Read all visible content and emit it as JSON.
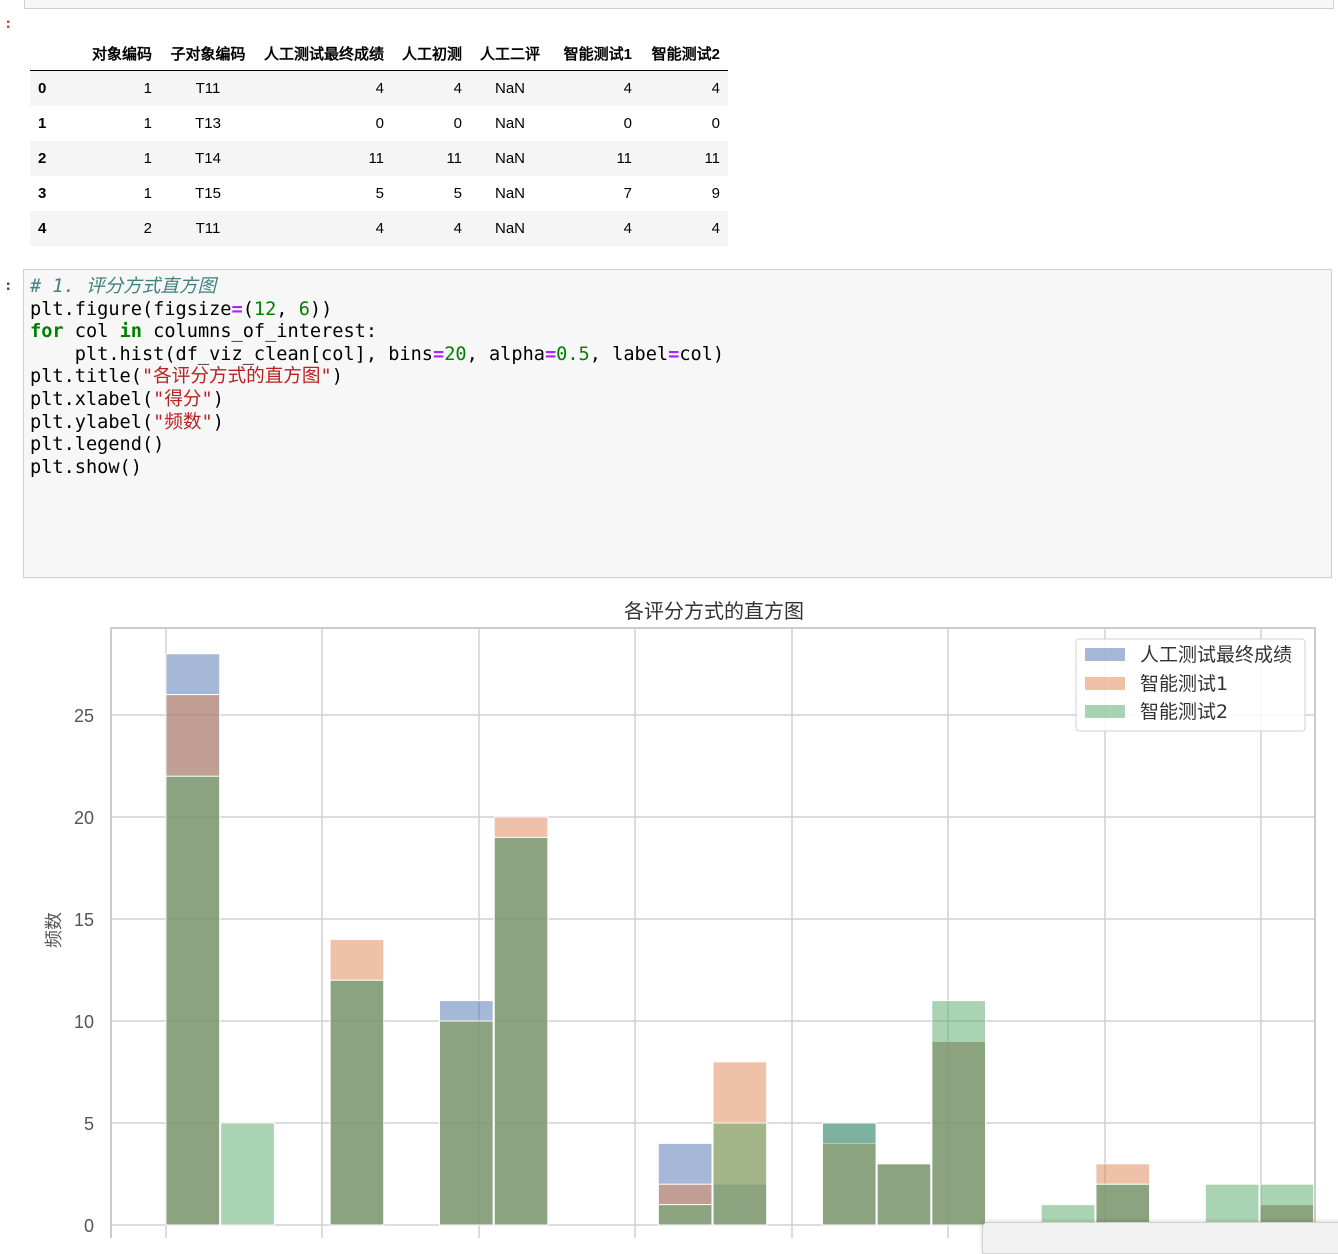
{
  "prompts": {
    "output": ":",
    "input": ":"
  },
  "dataframe": {
    "columns": [
      "对象编码",
      "子对象编码",
      "人工测试最终成绩",
      "人工初测",
      "人工二评",
      "智能测试1",
      "智能测试2"
    ],
    "rows": [
      {
        "index": "0",
        "cells": [
          "1",
          "T11",
          "4",
          "4",
          "NaN",
          "4",
          "4"
        ]
      },
      {
        "index": "1",
        "cells": [
          "1",
          "T13",
          "0",
          "0",
          "NaN",
          "0",
          "0"
        ]
      },
      {
        "index": "2",
        "cells": [
          "1",
          "T14",
          "11",
          "11",
          "NaN",
          "11",
          "11"
        ]
      },
      {
        "index": "3",
        "cells": [
          "1",
          "T15",
          "5",
          "5",
          "NaN",
          "7",
          "9"
        ]
      },
      {
        "index": "4",
        "cells": [
          "2",
          "T11",
          "4",
          "4",
          "NaN",
          "4",
          "4"
        ]
      }
    ]
  },
  "code": {
    "line1": "# 1. 评分方式直方图",
    "fig_prefix": "plt.figure(figsize",
    "fig_eq": "=",
    "fig_open": "(",
    "fig_n1": "12",
    "fig_comma": ", ",
    "fig_n2": "6",
    "fig_close": "))",
    "for_kw": "for",
    "for_mid": " col ",
    "in_kw": "in",
    "for_rest": " columns_of_interest:",
    "hist_a": "    plt.hist(df_viz_clean[col], bins",
    "eq1": "=",
    "bins_val": "20",
    "hist_b": ", alpha",
    "eq2": "=",
    "alpha_val": "0.5",
    "hist_c": ", label",
    "eq3": "=",
    "hist_d": "col)",
    "title_a": "plt.title(",
    "title_str": "\"各评分方式的直方图\"",
    "title_b": ")",
    "xlabel_a": "plt.xlabel(",
    "xlabel_str": "\"得分\"",
    "xlabel_b": ")",
    "ylabel_a": "plt.ylabel(",
    "ylabel_str": "\"频数\"",
    "ylabel_b": ")",
    "legend_line": "plt.legend()",
    "show_line": "plt.show()"
  },
  "colors": {
    "series1": "#4c72b0",
    "series2": "#dd8452",
    "series3": "#55a868",
    "grid": "#d0d0d0"
  },
  "chart_data": {
    "type": "bar",
    "title": "各评分方式的直方图",
    "xlabel": "",
    "ylabel": "频数",
    "ylim": [
      0,
      28.5
    ],
    "yticks": [
      0,
      5,
      10,
      15,
      20,
      25
    ],
    "alpha": 0.5,
    "legend_position": "top-right",
    "bins": [
      0,
      1,
      2,
      3,
      4,
      5,
      6,
      7,
      8,
      9,
      10,
      11,
      12,
      13,
      14,
      15,
      16,
      17,
      18,
      19,
      20
    ],
    "series": [
      {
        "name": "人工测试最终成绩",
        "values": [
          28,
          0,
          0,
          12,
          0,
          11,
          19,
          0,
          0,
          4,
          2,
          0,
          5,
          3,
          9,
          0,
          0,
          2,
          0,
          0,
          1
        ]
      },
      {
        "name": "智能测试1",
        "values": [
          26,
          0,
          0,
          14,
          0,
          10,
          20,
          0,
          0,
          2,
          8,
          0,
          4,
          3,
          9,
          0,
          0,
          3,
          0,
          0,
          1
        ]
      },
      {
        "name": "智能测试2",
        "values": [
          22,
          5,
          0,
          12,
          0,
          10,
          19,
          0,
          0,
          1,
          5,
          0,
          5,
          3,
          11,
          0,
          1,
          2,
          0,
          2,
          2
        ]
      }
    ]
  }
}
